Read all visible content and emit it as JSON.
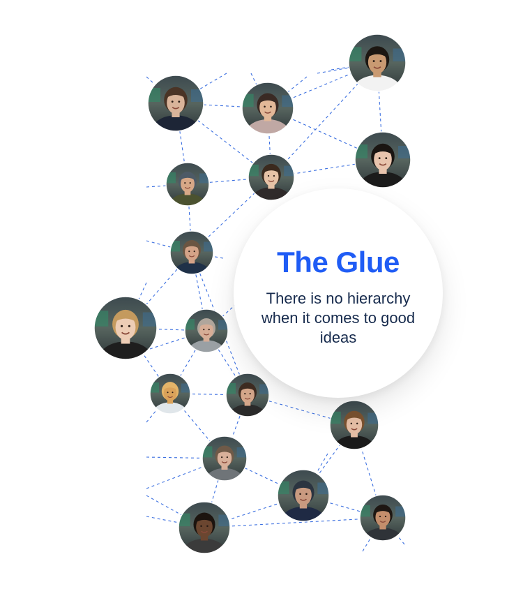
{
  "card": {
    "title": "The Glue",
    "subtitle": "There is no hierarchy when it comes to good ideas"
  },
  "colors": {
    "accent": "#1f5cf5",
    "text": "#172b4d",
    "link_line": "#3b6fe0"
  },
  "people": [
    {
      "name": "photo-man-suit"
    },
    {
      "name": "photo-woman-floral"
    },
    {
      "name": "photo-man-smiling-top"
    },
    {
      "name": "photo-woman-dark-hair"
    },
    {
      "name": "photo-man-cap"
    },
    {
      "name": "photo-woman-glasses"
    },
    {
      "name": "photo-man-navy-polo"
    },
    {
      "name": "photo-woman-blonde"
    },
    {
      "name": "photo-man-bald"
    },
    {
      "name": "photo-dog"
    },
    {
      "name": "photo-man-beard"
    },
    {
      "name": "photo-woman-ponytail"
    },
    {
      "name": "photo-man-glasses-beard"
    },
    {
      "name": "photo-man-cap-sunglasses"
    },
    {
      "name": "photo-man-smiling-bottom"
    },
    {
      "name": "photo-woman-smiling"
    }
  ]
}
